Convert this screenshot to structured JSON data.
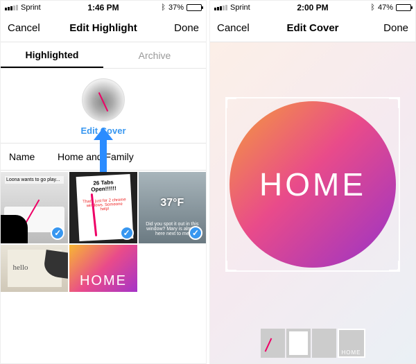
{
  "left": {
    "status": {
      "carrier": "Sprint",
      "time": "1:46 PM",
      "battery_pct": "37%",
      "bluetooth": "✱"
    },
    "nav": {
      "cancel": "Cancel",
      "title": "Edit Highlight",
      "done": "Done"
    },
    "tabs": {
      "highlighted": "Highlighted",
      "archive": "Archive"
    },
    "cover": {
      "edit_label": "Edit Cover"
    },
    "name": {
      "label": "Name",
      "value": "Home and Family"
    },
    "tiles": {
      "t1_caption": "Loona wants to go play...",
      "t2_header": "26 Tabs Open!!!!!!",
      "t2_red": "That's just for 2 chrome windows. Someone help!",
      "t3_temp": "37°F",
      "t3_caption": "Did you spot it out in this window? Mary is almost here next to me",
      "t4_script": "hello",
      "t5_text": "HOME"
    }
  },
  "right": {
    "status": {
      "carrier": "Sprint",
      "time": "2:00 PM",
      "battery_pct": "47%",
      "bluetooth": "✱"
    },
    "nav": {
      "cancel": "Cancel",
      "title": "Edit Cover",
      "done": "Done"
    },
    "circle_text": "HOME",
    "thumb4_label": "HOME"
  }
}
